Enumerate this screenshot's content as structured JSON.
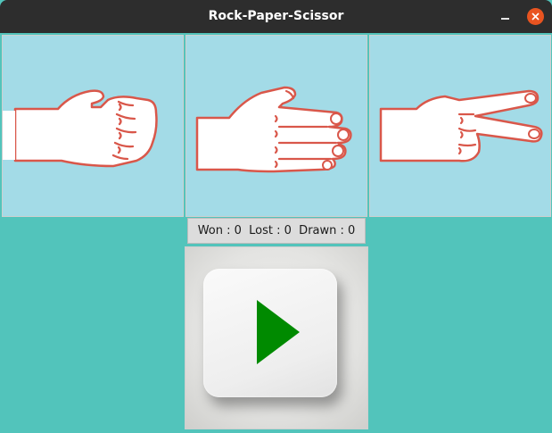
{
  "window": {
    "title": "Rock-Paper-Scissor"
  },
  "score": {
    "text": "Won : 0  Lost : 0  Drawn : 0"
  },
  "colors": {
    "background": "#52c4bb",
    "panel_background": "#a3dbe7",
    "hand_outline": "#d9574a",
    "play_icon": "#008a00",
    "close_button": "#e95420"
  },
  "choices": [
    {
      "name": "rock",
      "icon": "rock-hand-icon"
    },
    {
      "name": "paper",
      "icon": "paper-hand-icon"
    },
    {
      "name": "scissor",
      "icon": "scissor-hand-icon"
    }
  ],
  "play": {
    "icon": "play-icon"
  }
}
